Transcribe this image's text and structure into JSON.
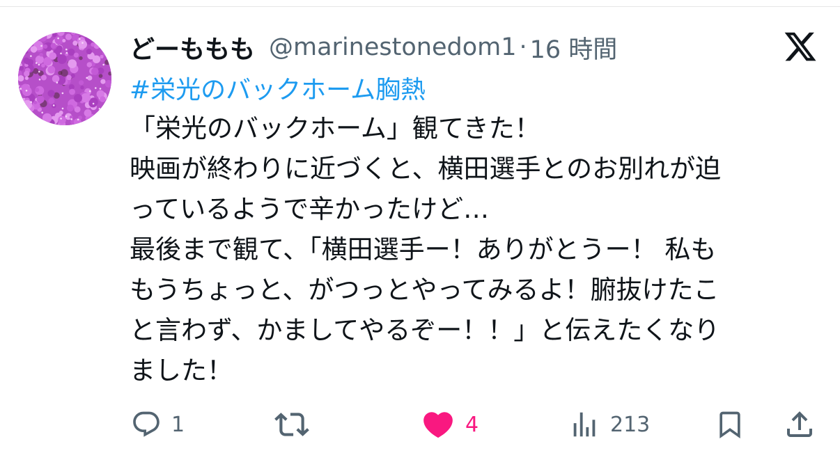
{
  "tweet": {
    "display_name": "どーももも",
    "handle": "@marinestonedom1",
    "separator": "·",
    "time": "16 時間",
    "hashtag": "#栄光のバックホーム胸熱",
    "lines": [
      "「栄光のバックホーム」観てきた！",
      "映画が終わりに近づくと、横田選手とのお別れが迫",
      "っているようで辛かったけど…",
      "最後まで観て、「横田選手ー！ありがとうー！ 私も",
      "もうちょっと、がつっとやってみるよ！腑抜けたこ",
      "と言わず、かましてやるぞー！！」と伝えたくなり",
      "ました！"
    ]
  },
  "actions": {
    "reply_count": "1",
    "retweet_count": "",
    "like_count": "4",
    "views_count": "213"
  },
  "icons": {
    "avatar": "pink-flowers-avatar",
    "logo": "x-logo-icon",
    "reply": "reply-icon",
    "retweet": "retweet-icon",
    "like": "heart-icon",
    "views": "views-icon",
    "bookmark": "bookmark-icon",
    "share": "share-icon"
  },
  "colors": {
    "text": "#0f1419",
    "secondary": "#536471",
    "hashtag": "#1d9bf0",
    "like": "#f91880"
  }
}
